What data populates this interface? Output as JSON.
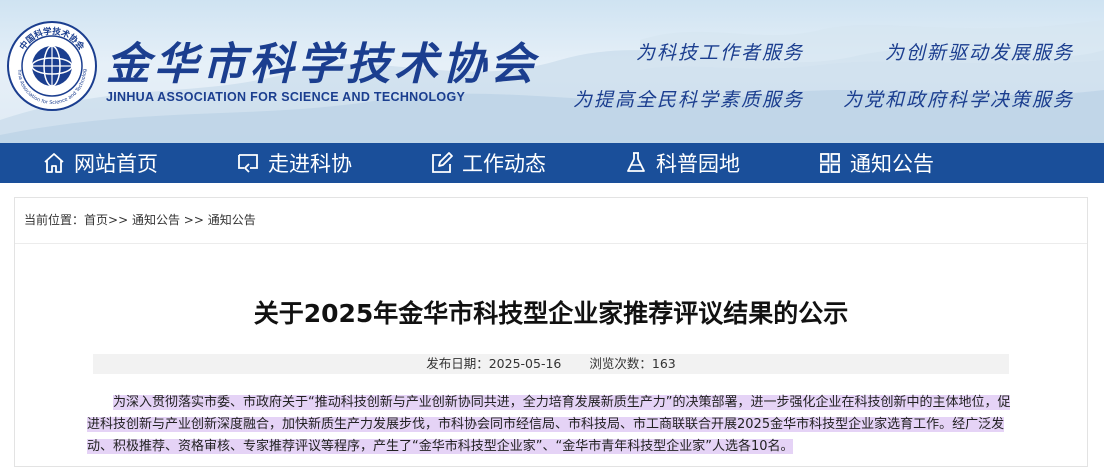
{
  "header": {
    "logo_ring_text": "中国科学技术协会",
    "logo_ring_text_en": "China Association for Science and Technology",
    "org_name_cn": "金华市科学技术协会",
    "org_name_en": "JINHUA ASSOCIATION FOR SCIENCE AND TECHNOLOGY",
    "slogans": [
      "为科技工作者服务",
      "为创新驱动发展服务",
      "为提高全民科学素质服务",
      "为党和政府科学决策服务"
    ]
  },
  "nav": {
    "items": [
      {
        "label": "网站首页",
        "icon": "home-icon"
      },
      {
        "label": "走进科协",
        "icon": "screen-arrow-icon"
      },
      {
        "label": "工作动态",
        "icon": "edit-icon"
      },
      {
        "label": "科普园地",
        "icon": "flask-icon"
      },
      {
        "label": "通知公告",
        "icon": "grid-icon"
      }
    ]
  },
  "breadcrumb": {
    "prefix": "当前位置：",
    "items": [
      "首页",
      "通知公告",
      "通知公告"
    ],
    "sep1": ">>",
    "sep2": " >> "
  },
  "article": {
    "title": "关于2025年金华市科技型企业家推荐评议结果的公示",
    "publish_label": "发布日期：2025-05-16",
    "views_label": "浏览次数：163",
    "body": "为深入贯彻落实市委、市政府关于“推动科技创新与产业创新协同共进，全力培育发展新质生产力”的决策部署，进一步强化企业在科技创新中的主体地位，促进科技创新与产业创新深度融合，加快新质生产力发展步伐，市科协会同市经信局、市科技局、市工商联联合开展2025金华市科技型企业家选育工作。经广泛发动、积极推荐、资格审核、专家推荐评议等程序，产生了“金华市科技型企业家”、“金华市青年科技型企业家”人选各10名。"
  },
  "colors": {
    "nav_bg": "#1a4f9a",
    "brand_blue": "#1b3e8f",
    "highlight": "#e5d3f6"
  }
}
